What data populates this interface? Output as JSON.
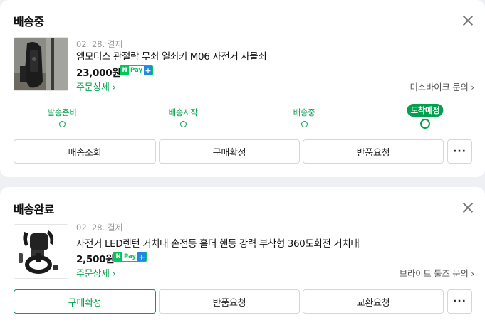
{
  "orders": [
    {
      "status": "배송중",
      "date": "02. 28. 결제",
      "product_name": "엠모터스 관절락 무쇠 열쇠키 M06 자전거 자물쇠",
      "price": "23,000원",
      "npay": {
        "n": "N",
        "pay": "Pay",
        "plus": "+"
      },
      "detail_link": "주문상세 ›",
      "seller_link": "미소바이크 문의 ›",
      "tracker": {
        "steps": [
          "발송준비",
          "배송시작",
          "배송중"
        ],
        "current": "도착예정"
      },
      "buttons": [
        "배송조회",
        "구매확정",
        "반품요청"
      ],
      "more": "···"
    },
    {
      "status": "배송완료",
      "date": "02. 28. 결제",
      "product_name": "자전거 LED렌턴 거치대 손전등 홀더 핸등 강력 부착형 360도회전 거치대",
      "price": "2,500원",
      "npay": {
        "n": "N",
        "pay": "Pay",
        "plus": "+"
      },
      "detail_link": "주문상세 ›",
      "seller_link": "브라이트 툴즈 문의 ›",
      "buttons": [
        "구매확정",
        "반품요청",
        "교환요청"
      ],
      "more": "···"
    }
  ],
  "colors": {
    "accent": "#03a14e",
    "npay_green": "#03c75a",
    "npay_blue": "#1e88e5"
  },
  "icons": {
    "close": "close-icon",
    "more": "more-dots-icon"
  }
}
